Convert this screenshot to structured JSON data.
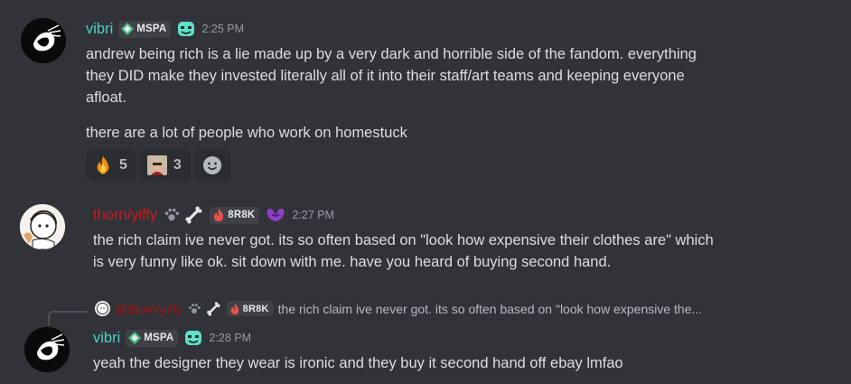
{
  "messages": [
    {
      "username": "vibri",
      "tag": "MSPA",
      "timestamp": "2:25 PM",
      "lines": [
        "andrew being rich is a lie made up by a very dark and horrible side of the fandom.  everything",
        "they DID make they invested literally all of it into their staff/art teams and keeping everyone",
        "afloat."
      ],
      "second_paragraph": "there are a lot of people who work on homestuck",
      "reactions": [
        {
          "emoji": "fire-emoji",
          "count": "5"
        },
        {
          "emoji": "custom-face-emoji",
          "count": "3"
        }
      ]
    },
    {
      "username": "thorn/yiffy",
      "tag": "8R8K",
      "timestamp": "2:27 PM",
      "lines": [
        "the rich claim ive never got. its so often based on \"look how expensive their clothes are\" which",
        "is very funny like ok. sit down with me. have you heard of buying second hand."
      ]
    },
    {
      "reply": {
        "username": "@thorn/yiffy",
        "tag": "8R8K",
        "text": "the rich claim ive never got. its so often based on \"look how expensive the..."
      },
      "username": "vibri",
      "tag": "MSPA",
      "timestamp": "2:28 PM",
      "lines": [
        "yeah the designer they wear is ironic and they buy it second hand off ebay lmfao"
      ]
    }
  ],
  "colors": {
    "background": "#313338",
    "vibri_name": "#4ad0c6",
    "thorn_name": "#c81c1c"
  }
}
